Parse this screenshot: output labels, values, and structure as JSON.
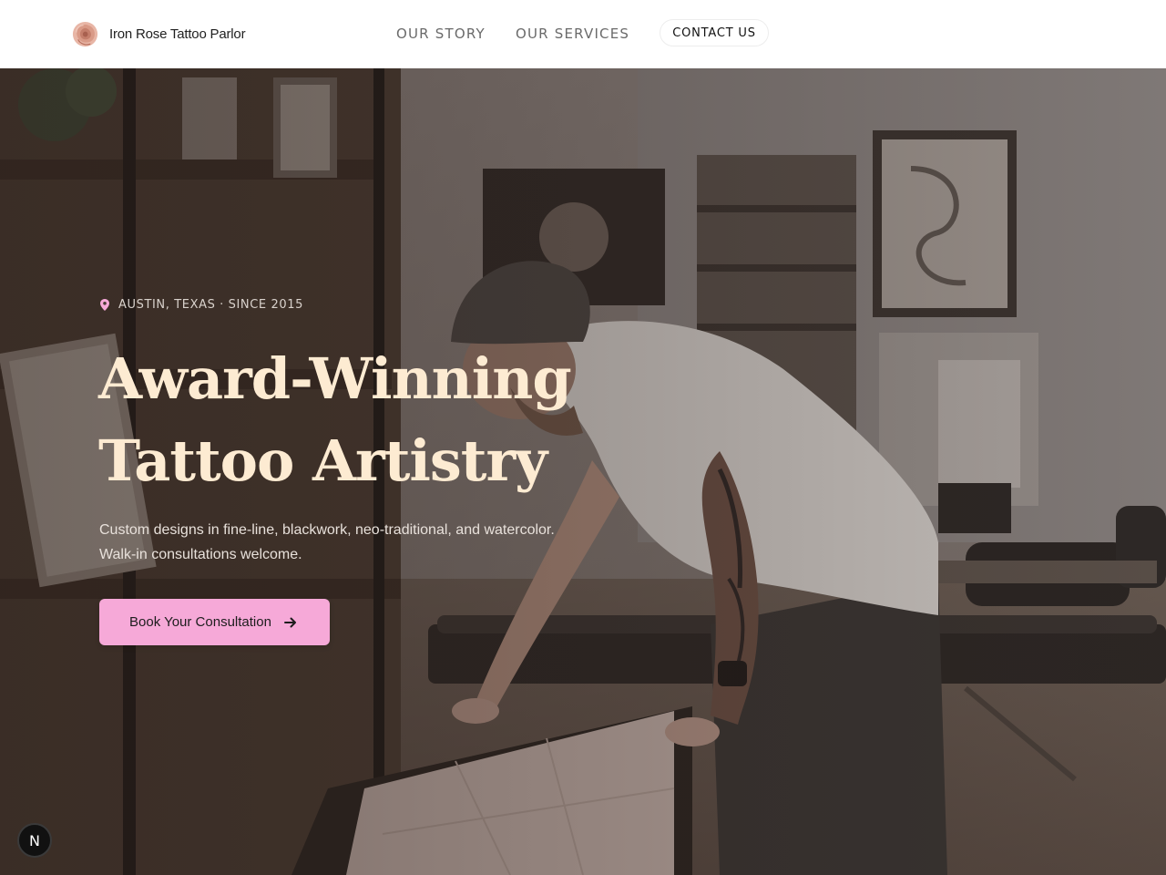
{
  "brand": {
    "name": "Iron Rose Tattoo Parlor",
    "logo_icon": "rose-logo-icon"
  },
  "nav": {
    "items": [
      {
        "label": "OUR STORY"
      },
      {
        "label": "OUR SERVICES"
      }
    ],
    "contact_label": "CONTACT US"
  },
  "hero": {
    "background_image": "tattoo artist leaning over a stencil sheet on a table in a studio",
    "location_icon": "map-pin-icon",
    "eyebrow": "AUSTIN, TEXAS · SINCE 2015",
    "headline_line1": "Award-Winning",
    "headline_line2": "Tattoo Artistry",
    "subtitle_line1": "Custom designs in fine-line, blackwork, neo-traditional, and watercolor.",
    "subtitle_line2": "Walk-in consultations welcome.",
    "cta_label": "Book Your Consultation",
    "cta_icon": "arrow-right-icon"
  },
  "dev_badge": {
    "label": "N",
    "icon": "nextjs-badge-icon"
  },
  "colors": {
    "header_bg": "#ffffff",
    "headline": "#fdebd2",
    "accent_pink": "#f6a9d8",
    "pin": "#f6a9d8"
  }
}
